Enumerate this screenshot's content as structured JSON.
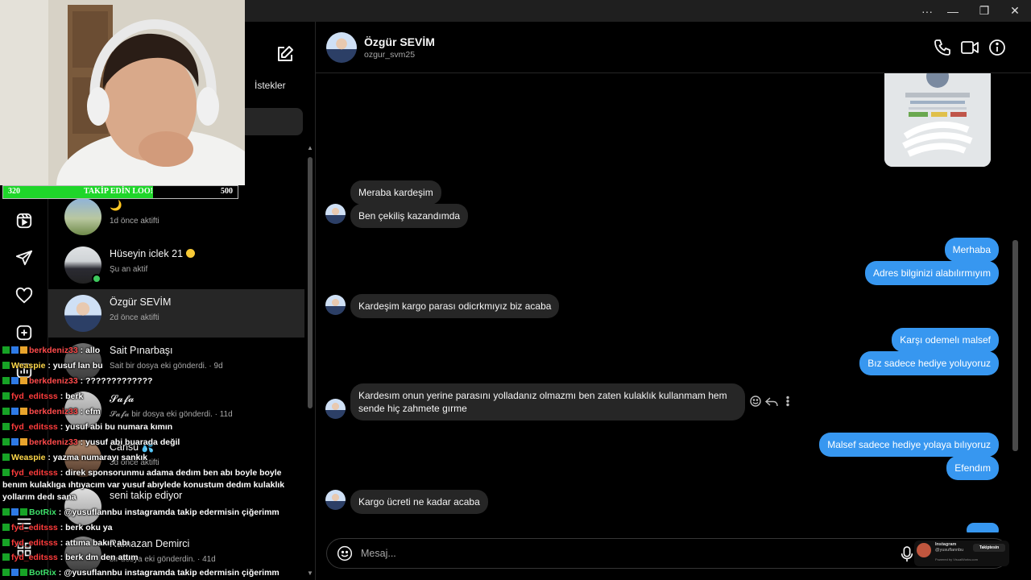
{
  "window": {
    "more": "···",
    "minimize": "—",
    "restore": "❐",
    "close": "✕"
  },
  "sidebar_rail": {
    "icons": [
      "reels-icon",
      "send-icon",
      "heart-icon",
      "new-post-icon",
      "stats-icon",
      "more-icon"
    ]
  },
  "inbox": {
    "requests_label": "İstekler",
    "conversations": [
      {
        "name": "🌙",
        "sub": "1d önce aktifti",
        "active": false
      },
      {
        "name": "Hüseyin iclek 21",
        "sub": "Şu an aktif",
        "active": false,
        "online": true
      },
      {
        "name": "Özgür SEVİM",
        "sub": "2d önce aktifti",
        "active": true
      },
      {
        "name": "Sait Pınarbaşı",
        "sub": "Sait bir dosya eki gönderdi. · 9d",
        "active": false
      },
      {
        "name": "𝓢𝓪𝓯𝓪",
        "sub": "𝓢𝓪𝓯𝓪 bir dosya eki gönderdi. · 11d",
        "active": false
      },
      {
        "name": "Cansu 💦",
        "sub": "3d önce aktifti",
        "active": false
      },
      {
        "name": "seni takip ediyor",
        "sub": "",
        "active": false
      },
      {
        "name": "Ramazan Demirci",
        "sub": "bir dosya eki gönderdin. · 41d",
        "active": false
      }
    ]
  },
  "follow_goal": {
    "current": "320",
    "label": "TAKİP EDİN LOO!",
    "target": "500",
    "progress": 0.64,
    "color": "#1fd62a"
  },
  "twitch_chat": [
    {
      "user": "berkdeniz33",
      "color": "#ff4b4b",
      "badges": [
        "green",
        "blue",
        "yellow"
      ],
      "text": "allo"
    },
    {
      "user": "Weaspie",
      "color": "#ffd84a",
      "badges": [
        "green"
      ],
      "text": "yusuf lan bu"
    },
    {
      "user": "berkdeniz33",
      "color": "#ff4b4b",
      "badges": [
        "green",
        "blue",
        "yellow"
      ],
      "text": "?????????????"
    },
    {
      "user": "fyd_editsss",
      "color": "#ff3c3c",
      "badges": [
        "green"
      ],
      "text": "berk"
    },
    {
      "user": "berkdeniz33",
      "color": "#ff4b4b",
      "badges": [
        "green",
        "blue",
        "yellow"
      ],
      "text": "efm"
    },
    {
      "user": "fyd_editsss",
      "color": "#ff3c3c",
      "badges": [
        "green"
      ],
      "text": "yusuf abi bu numara kımın"
    },
    {
      "user": "berkdeniz33",
      "color": "#ff4b4b",
      "badges": [
        "green",
        "blue",
        "yellow"
      ],
      "text": "yusuf abi buarada değil"
    },
    {
      "user": "Weaspie",
      "color": "#ffd84a",
      "badges": [
        "green"
      ],
      "text": "yazma numarayı sankık"
    },
    {
      "user": "fyd_editsss",
      "color": "#ff3c3c",
      "badges": [
        "green"
      ],
      "text": "direk sponsorunmu adama dedım ben abı boyle boyle benım kulaklıga ıhtıyacım var yusuf abıylede konustum dedım kulaklık yollarım dedı sana",
      "wrap": true
    },
    {
      "user": "BotRix",
      "color": "#3ee06a",
      "badges": [
        "green",
        "blue",
        "green"
      ],
      "text": "@yusuflannbu instagramda takip edermisin çiğerimm"
    },
    {
      "user": "fyd_editsss",
      "color": "#ff3c3c",
      "badges": [
        "green"
      ],
      "text": "berk oku ya"
    },
    {
      "user": "fyd_editsss",
      "color": "#ff3c3c",
      "badges": [
        "green"
      ],
      "text": "attıma bakın abı"
    },
    {
      "user": "fyd_editsss",
      "color": "#ff3c3c",
      "badges": [
        "green"
      ],
      "text": "berk dm den attım"
    },
    {
      "user": "BotRix",
      "color": "#3ee06a",
      "badges": [
        "green",
        "blue",
        "green"
      ],
      "text": "@yusuflannbu instagramda takip edermisin çiğerimm"
    }
  ],
  "thread": {
    "name": "Özgür SEVİM",
    "username": "ozgur_svm25",
    "messages": [
      {
        "dir": "in",
        "text": "Meraba kardeşim"
      },
      {
        "dir": "in",
        "text": "Ben çekiliş kazandımda"
      },
      {
        "dir": "out",
        "text": "Merhaba"
      },
      {
        "dir": "out",
        "text": "Adres bilginizi alabılırmıyım"
      },
      {
        "dir": "in",
        "text": "Kardeşim kargo parası odicrkmıyız biz acaba"
      },
      {
        "dir": "out",
        "text": "Karşı odemelı malsef"
      },
      {
        "dir": "out",
        "text": "Bız sadece hediye yoluyoruz"
      },
      {
        "dir": "in",
        "text": "Kardesım onun yerine parasını yolladanız olmazmı ben zaten kulaklık kullanmam hem sende hiç zahmete gırme"
      },
      {
        "dir": "out",
        "text": "Malsef sadece hediye yolaya bılıyoruz"
      },
      {
        "dir": "out",
        "text": "Efendım"
      },
      {
        "dir": "in",
        "text": "Kargo ücreti ne kadar acaba"
      }
    ],
    "shared_image_name": "ozgur_svm25"
  },
  "composer": {
    "placeholder": "Mesaj..."
  },
  "promo": {
    "title": "Instagram",
    "handle": "@yusuflannbu",
    "button": "Takiptesin",
    "footer": "Powered by VisualWorks.com"
  },
  "colors": {
    "accent_blue": "#3797f0",
    "bubble_gray": "#262626",
    "online_green": "#3ec95d"
  }
}
